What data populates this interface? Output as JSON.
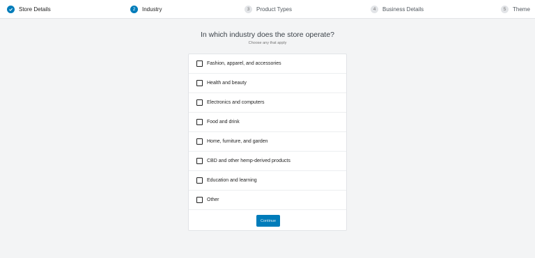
{
  "stepper": {
    "steps": [
      {
        "number": "",
        "label": "Store Details",
        "state": "done"
      },
      {
        "number": "2",
        "label": "Industry",
        "state": "active"
      },
      {
        "number": "3",
        "label": "Product Types",
        "state": "pending"
      },
      {
        "number": "4",
        "label": "Business Details",
        "state": "pending"
      },
      {
        "number": "5",
        "label": "Theme",
        "state": "pending"
      }
    ]
  },
  "main": {
    "title": "In which industry does the store operate?",
    "subtitle": "Choose any that apply",
    "options": [
      {
        "label": "Fashion, apparel, and accessories",
        "checked": false
      },
      {
        "label": "Health and beauty",
        "checked": false
      },
      {
        "label": "Electronics and computers",
        "checked": false
      },
      {
        "label": "Food and drink",
        "checked": false
      },
      {
        "label": "Home, furniture, and garden",
        "checked": false
      },
      {
        "label": "CBD and other hemp-derived products",
        "checked": false
      },
      {
        "label": "Education and learning",
        "checked": false
      },
      {
        "label": "Other",
        "checked": false
      }
    ],
    "continue_label": "Continue"
  },
  "colors": {
    "accent": "#007cba",
    "background": "#f3f4f5"
  }
}
